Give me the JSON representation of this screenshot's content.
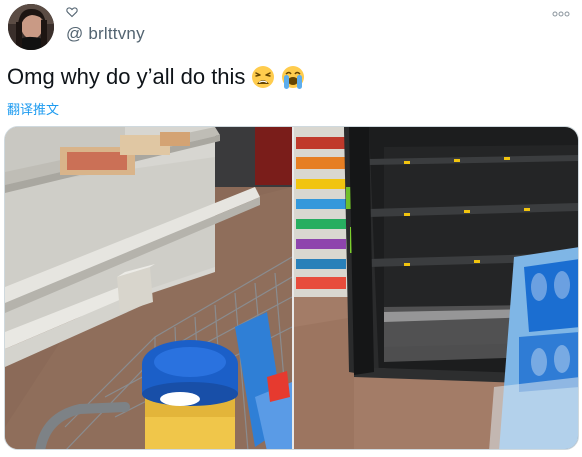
{
  "tweet": {
    "handle": "@ brlttvny",
    "text": "Omg why do y’all do this",
    "translate_label": "翻译推文"
  },
  "icons": {
    "heart": "heart-icon",
    "more": "more-options-icon",
    "emoji_1": "weary-face-emoji",
    "emoji_2": "loudly-crying-face-emoji"
  },
  "colors": {
    "link": "#1d9bf0",
    "secondary_text": "#536471",
    "primary_text": "#0f1419"
  }
}
